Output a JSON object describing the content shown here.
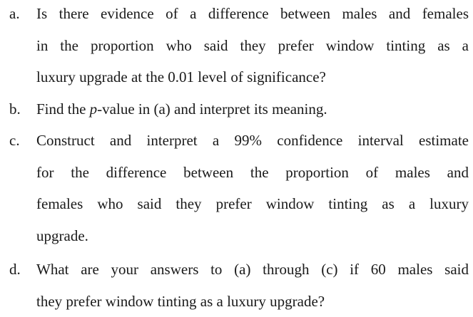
{
  "questions": [
    {
      "marker": "a.",
      "lines": [
        "Is there evidence of a difference between males and females",
        "in the proportion who said they prefer window tinting as a",
        "luxury upgrade at the 0.01 level of significance?"
      ]
    },
    {
      "marker": "b.",
      "pre": "Find the ",
      "italic": "p",
      "post": "-value in (a) and interpret its meaning."
    },
    {
      "marker": "c.",
      "lines": [
        "Construct and interpret a 99% confidence interval estimate",
        "for the difference between the proportion of males and",
        "females who said they prefer window tinting as a luxury",
        "upgrade."
      ]
    },
    {
      "marker": "d.",
      "lines": [
        "What are your answers to (a) through (c) if 60 males said",
        "they prefer window tinting as a luxury upgrade?"
      ]
    }
  ]
}
